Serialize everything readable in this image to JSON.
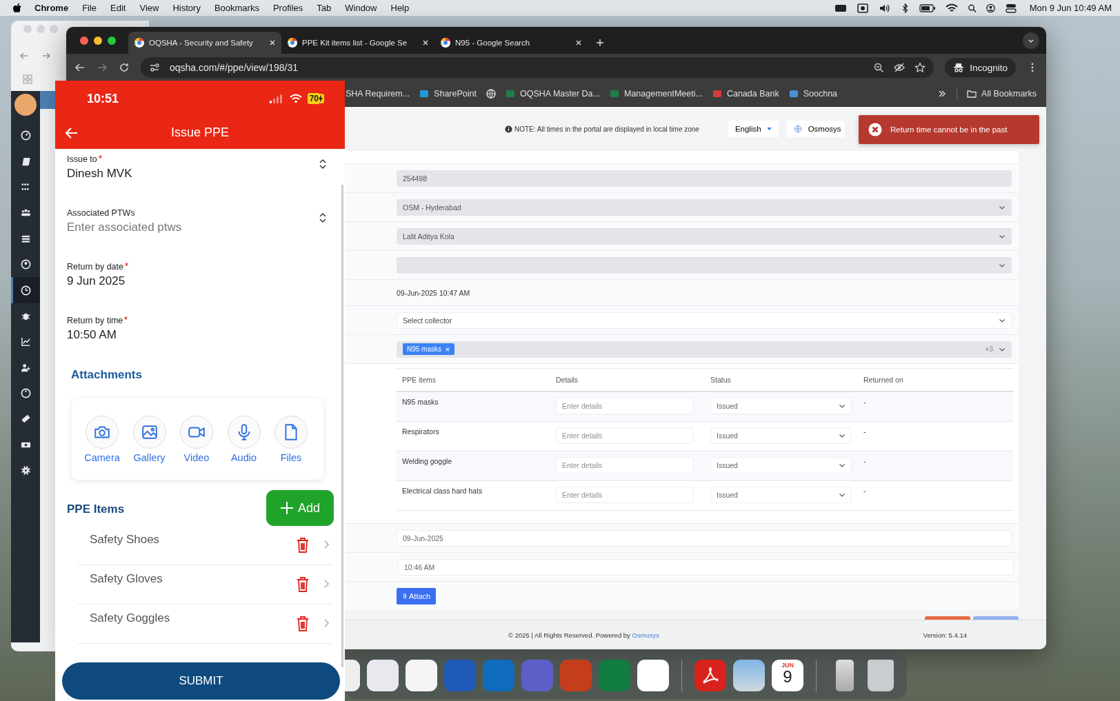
{
  "menu_bar": {
    "app": "Chrome",
    "items": [
      "File",
      "Edit",
      "View",
      "History",
      "Bookmarks",
      "Profiles",
      "Tab",
      "Window",
      "Help"
    ],
    "clock": "Mon 9 Jun  10:49 AM"
  },
  "back_window": {
    "sidebar_items": [
      {
        "selected": false
      },
      {
        "selected": false
      },
      {
        "selected": false
      },
      {
        "selected": false
      },
      {
        "selected": false
      },
      {
        "selected": false
      },
      {
        "selected": true
      },
      {
        "selected": false
      },
      {
        "selected": false
      },
      {
        "selected": false
      },
      {
        "selected": false
      },
      {
        "selected": false
      },
      {
        "selected": false
      },
      {
        "selected": false
      }
    ]
  },
  "browser": {
    "tabs": [
      {
        "title": "OQSHA - Security and Safety",
        "selected": true
      },
      {
        "title": "PPE Kit items list - Google Se",
        "selected": false
      },
      {
        "title": "N95 - Google Search",
        "selected": false
      }
    ],
    "url": "oqsha.com/#/ppe/view/198/31",
    "profile": "Incognito",
    "bookmarks": [
      {
        "kind": "link",
        "label": "SHA Requirem..."
      },
      {
        "kind": "link",
        "label": "SharePoint"
      },
      {
        "kind": "icon"
      },
      {
        "kind": "link",
        "label": "OQSHA Master Da..."
      },
      {
        "kind": "link",
        "label": "ManagementMeeti..."
      },
      {
        "kind": "link",
        "label": "Canada Bank"
      },
      {
        "kind": "link",
        "label": "Soochna"
      }
    ],
    "all_bookmarks": "All Bookmarks"
  },
  "page": {
    "note": "NOTE: All times in the portal are displayed in local time zone",
    "language": "English",
    "organisation": "Osmosys",
    "toast": "Return time cannot be in the past",
    "form_rows": [
      {
        "kind": "input",
        "disabled": true,
        "value": "254498"
      },
      {
        "kind": "select",
        "disabled": true,
        "value": "OSM - Hyderabad"
      },
      {
        "kind": "select",
        "disabled": true,
        "value": "Lalit Aditya Kola"
      },
      {
        "kind": "select",
        "disabled": true
      },
      {
        "kind": "text",
        "value": "09-Jun-2025 10:47 AM"
      },
      {
        "kind": "select",
        "disabled": false,
        "placeholder": "Select collector"
      },
      {
        "kind": "multiselect",
        "disabled": true,
        "tags": [
          "N95 masks"
        ],
        "more": "+3"
      }
    ],
    "table": {
      "columns": [
        "PPE items",
        "Details",
        "Status",
        "Returned on"
      ],
      "rows": [
        {
          "item": "N95 masks",
          "details_placeholder": "Enter details",
          "status": "Issued",
          "returned_on": "-"
        },
        {
          "item": "Respirators",
          "details_placeholder": "Enter details",
          "status": "Issued",
          "returned_on": "-"
        },
        {
          "item": "Welding goggle",
          "details_placeholder": "Enter details",
          "status": "Issued",
          "returned_on": "-"
        },
        {
          "item": "Electrical class hard hats",
          "details_placeholder": "Enter details",
          "status": "Issued",
          "returned_on": "-"
        }
      ]
    },
    "return_date": "09-Jun-2025",
    "return_time": "10:46 AM",
    "attach": "Attach",
    "footer": {
      "copyright": "© 2025 | All Rights Reserved. Powered by",
      "link": "Osmosys",
      "version": "Version: 5.4.14"
    }
  },
  "phone": {
    "time": "10:51",
    "battery": "70",
    "title": "Issue PPE",
    "fields": [
      {
        "kind": "select",
        "label": "Issue to",
        "required": true,
        "value": "Dinesh MVK"
      },
      {
        "kind": "select",
        "label": "Associated PTWs",
        "required": false,
        "placeholder": "Enter associated ptws"
      },
      {
        "kind": "date",
        "label": "Return by date",
        "required": true,
        "value": "9 Jun 2025"
      },
      {
        "kind": "time",
        "label": "Return by time",
        "required": true,
        "value": "10:50 AM"
      }
    ],
    "attachments_title": "Attachments",
    "attachments": [
      "Camera",
      "Gallery",
      "Video",
      "Audio",
      "Files"
    ],
    "items_title": "PPE Items",
    "add": "Add",
    "items": [
      "Safety Shoes",
      "Safety Gloves",
      "Safety Goggles"
    ],
    "submit": "SUBMIT"
  },
  "dock": {
    "calendar_month": "JUN",
    "calendar_day": "9"
  }
}
